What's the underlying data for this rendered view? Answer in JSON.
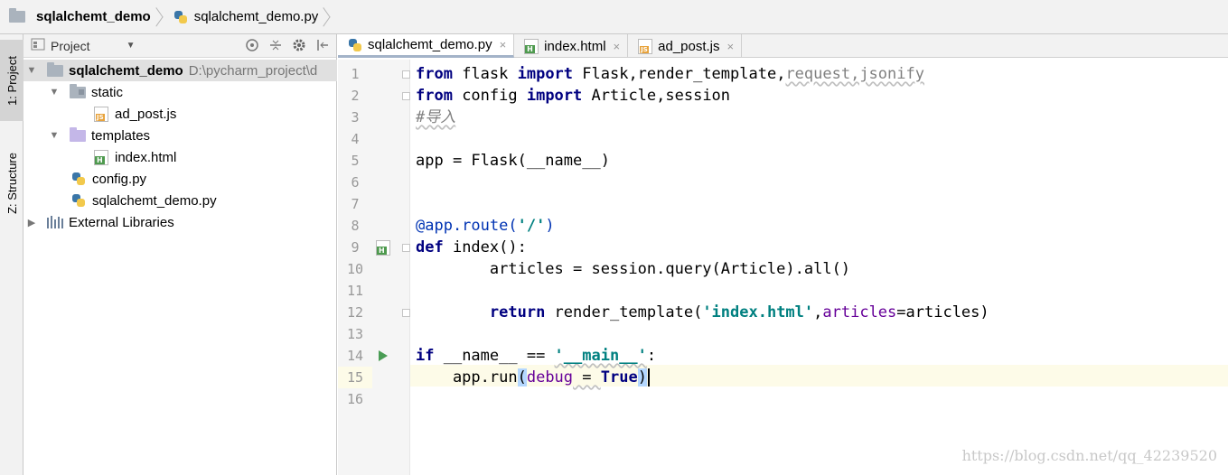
{
  "breadcrumb": {
    "items": [
      {
        "label": "sqlalchemt_demo",
        "icon": "folder-icon"
      },
      {
        "label": "sqlalchemt_demo.py",
        "icon": "python-file-icon"
      }
    ]
  },
  "toolstrip": {
    "project_tab": "1: Project",
    "structure_tab": "Z: Structure"
  },
  "project_panel": {
    "title": "Project",
    "dropdown_icon": "caret-down-icon",
    "tools": [
      "locate-icon",
      "collapse-icon",
      "settings-icon",
      "hide-icon"
    ]
  },
  "tree": {
    "root_label": "sqlalchemt_demo",
    "root_path": "D:\\pycharm_project\\d",
    "static_label": "static",
    "ad_post_label": "ad_post.js",
    "templates_label": "templates",
    "index_label": "index.html",
    "config_label": "config.py",
    "main_label": "sqlalchemt_demo.py",
    "ext_label": "External Libraries"
  },
  "tabs": [
    {
      "label": "sqlalchemt_demo.py",
      "icon": "python-file-icon",
      "active": true
    },
    {
      "label": "index.html",
      "icon": "html-file-icon",
      "active": false
    },
    {
      "label": "ad_post.js",
      "icon": "js-file-icon",
      "active": false
    }
  ],
  "close_glyph": "×",
  "line_numbers": [
    "1",
    "2",
    "3",
    "4",
    "5",
    "6",
    "7",
    "8",
    "9",
    "10",
    "11",
    "12",
    "13",
    "14",
    "15",
    "16"
  ],
  "code": {
    "l1_from": "from",
    "l1_mod": " flask ",
    "l1_import": "import",
    "l1_names": " Flask,render_template,",
    "l1_unused": "request,jsonify",
    "l2_from": "from",
    "l2_mod": " config ",
    "l2_import": "import",
    "l2_names": " Article,session",
    "l3_comment": "#导入",
    "l5": "app = Flask(__name__)",
    "l8_dec": "@app.route(",
    "l8_str": "'/'",
    "l8_end": ")",
    "l9_def": "def",
    "l9_rest": " index():",
    "l10": "        articles = session.query(Article).all()",
    "l12_indent": "        ",
    "l12_return": "return",
    "l12_call": " render_template(",
    "l12_str": "'index.html'",
    "l12_comma": ",",
    "l12_kw": "articles",
    "l12_end": "=articles)",
    "l14_if": "if",
    "l14_mid": " __name__ == ",
    "l14_str": "'__main__'",
    "l14_end": ":",
    "l15_pre": "    app.run",
    "l15_open": "(",
    "l15_kw": "debug",
    "l15_eq": " = ",
    "l15_true": "True",
    "l15_close": ")"
  },
  "watermark": "https://blog.csdn.net/qq_42239520"
}
